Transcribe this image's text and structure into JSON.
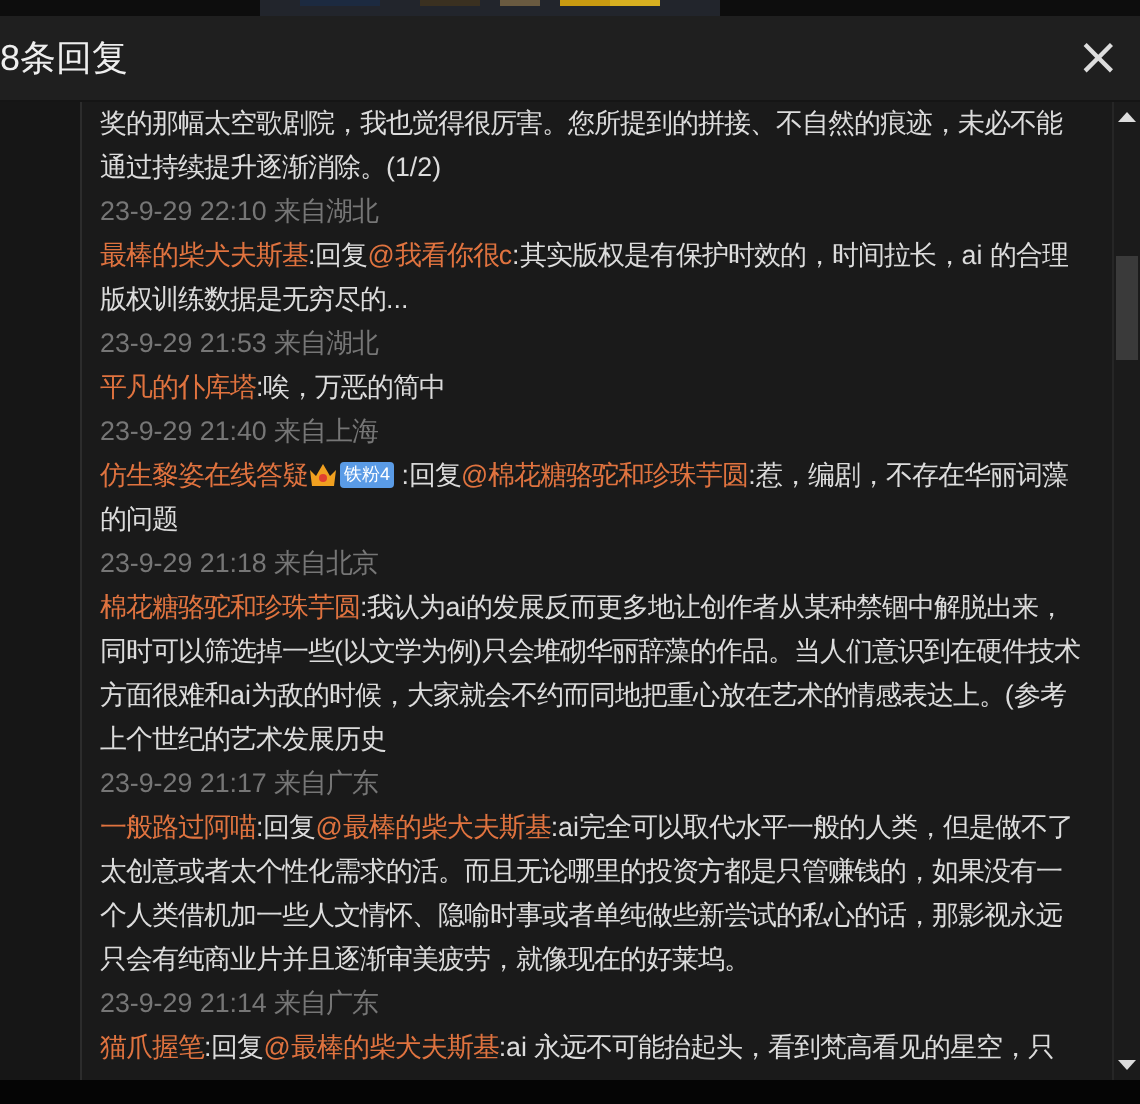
{
  "header": {
    "title": "8条回复",
    "close": "×"
  },
  "comments": [
    {
      "text": "奖的那幅太空歌剧院，我也觉得很厉害。您所提到的拼接、不自然的痕迹，未必不能通过持续提升逐渐消除。(1/2)",
      "time": "23-9-29 22:10 来自湖北"
    },
    {
      "author": "最棒的柴犬夫斯基",
      "reply": {
        "label": ":回复",
        "to": "@我看你很c"
      },
      "text": ":其实版权是有保护时效的，时间拉长，ai 的合理版权训练数据是无穷尽的...",
      "time": "23-9-29 21:53 来自湖北"
    },
    {
      "author": "平凡的仆库塔",
      "text": ":唉，万恶的简中",
      "time": "23-9-29 21:40 来自上海"
    },
    {
      "author": "仿生黎姿在线答疑",
      "badge": "铁粉4",
      "reply": {
        "label": " :回复",
        "to": "@棉花糖骆驼和珍珠芋圆"
      },
      "text": ":惹，编剧，不存在华丽词藻的问题",
      "time": "23-9-29 21:18 来自北京"
    },
    {
      "author": "棉花糖骆驼和珍珠芋圆",
      "text": ":我认为ai的发展反而更多地让创作者从某种禁锢中解脱出来，同时可以筛选掉一些(以文学为例)只会堆砌华丽辞藻的作品。当人们意识到在硬件技术方面很难和ai为敌的时候，大家就会不约而同地把重心放在艺术的情感表达上。(参考上个世纪的艺术发展历史",
      "time": "23-9-29 21:17 来自广东"
    },
    {
      "author": "一般路过阿喵",
      "reply": {
        "label": ":回复",
        "to": "@最棒的柴犬夫斯基"
      },
      "text": ":ai完全可以取代水平一般的人类，但是做不了太创意或者太个性化需求的活。而且无论哪里的投资方都是只管赚钱的，如果没有一个人类借机加一些人文情怀、隐喻时事或者单纯做些新尝试的私心的话，那影视永远只会有纯商业片并且逐渐审美疲劳，就像现在的好莱坞。",
      "time": "23-9-29 21:14 来自广东"
    },
    {
      "author": "猫爪握笔",
      "reply": {
        "label": ":回复",
        "to": "@最棒的柴犬夫斯基"
      },
      "text": ":ai 永远不可能抬起头，看到梵高看见的星空，只"
    }
  ]
}
